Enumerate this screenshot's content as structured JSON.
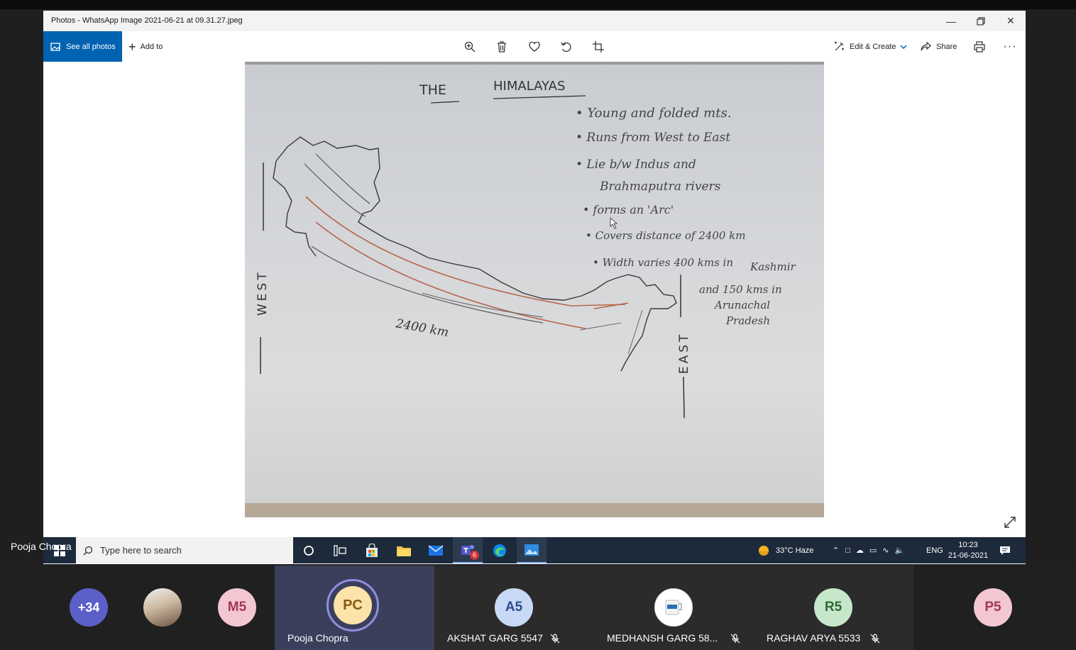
{
  "window": {
    "title": "Photos - WhatsApp Image 2021-06-21 at 09.31.27.jpeg",
    "minimize_icon": "minimize-icon",
    "maximize_icon": "restore-icon",
    "close_icon": "close-icon"
  },
  "toolbar": {
    "see_all_label": "See all photos",
    "add_to_label": "Add to",
    "edit_create_label": "Edit & Create",
    "share_label": "Share"
  },
  "whiteboard": {
    "title_a": "THE",
    "title_b": "HIMALAYAS",
    "bullets": [
      "• Young and folded mts.",
      "• Runs from West to East",
      "• Lie b/w Indus and",
      "Brahmaputra rivers",
      "• forms an 'Arc'",
      "• Covers distance of 2400 km",
      "• Width varies 400 kms in",
      "Kashmir",
      "and 150 kms in",
      "Arunachal",
      "Pradesh"
    ],
    "west_label": "WEST",
    "east_label": "EAST",
    "distance_label": "2400 km"
  },
  "taskbar": {
    "search_placeholder": "Type here to search",
    "weather": "33°C  Haze",
    "lang": "ENG",
    "time": "10:23",
    "date": "21-06-2021",
    "teams_badge": "6"
  },
  "presenter_label": "Pooja Chopra",
  "participants": [
    {
      "initials": "+34",
      "name": "",
      "color": "#5b5fc7"
    },
    {
      "initials": "",
      "name": "",
      "color": "#8a7a6a"
    },
    {
      "initials": "M5",
      "name": "",
      "color": "#f2c7d2"
    },
    {
      "initials": "PC",
      "name": "Pooja Chopra",
      "color": "#fbe3a9"
    },
    {
      "initials": "A5",
      "name": "AKSHAT GARG 5547",
      "color": "#c8d9f5"
    },
    {
      "initials": "",
      "name": "MEDHANSH GARG 58...",
      "color": "#ffffff"
    },
    {
      "initials": "R5",
      "name": "RAGHAV ARYA 5533",
      "color": "#c6e7c9"
    },
    {
      "initials": "P5",
      "name": "",
      "color": "#f2c7d2"
    }
  ]
}
